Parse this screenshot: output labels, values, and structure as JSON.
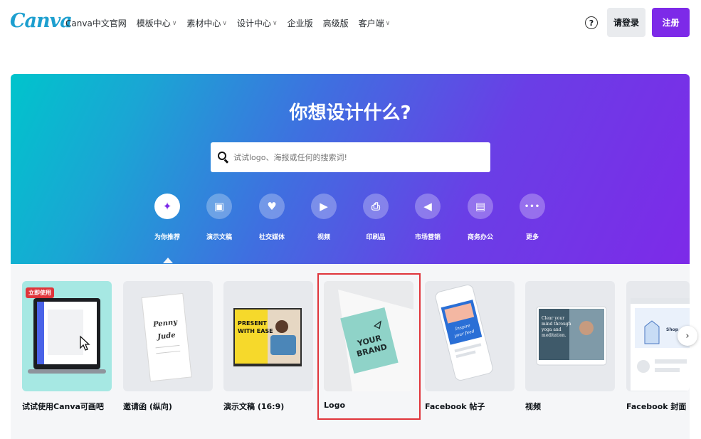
{
  "header": {
    "logo": "Canva",
    "nav": [
      {
        "label": "Canva中文官网",
        "has_chevron": false
      },
      {
        "label": "模板中心",
        "has_chevron": true
      },
      {
        "label": "素材中心",
        "has_chevron": true
      },
      {
        "label": "设计中心",
        "has_chevron": true
      },
      {
        "label": "企业版",
        "has_chevron": false
      },
      {
        "label": "高级版",
        "has_chevron": false
      },
      {
        "label": "客户端",
        "has_chevron": true
      }
    ],
    "chevron_glyph": "∨",
    "help_glyph": "?",
    "login_label": "请登录",
    "signup_label": "注册"
  },
  "hero": {
    "title": "你想设计什么?",
    "search_placeholder": "试试logo、海报或任何的搜索词!",
    "categories": [
      {
        "label": "为你推荐",
        "icon": "sparkle-icon",
        "glyph": "✦",
        "active": true
      },
      {
        "label": "演示文稿",
        "icon": "presentation-icon",
        "glyph": "▣",
        "active": false
      },
      {
        "label": "社交媒体",
        "icon": "social-heart-icon",
        "glyph": "♥",
        "active": false
      },
      {
        "label": "视频",
        "icon": "video-icon",
        "glyph": "▶",
        "active": false
      },
      {
        "label": "印刷品",
        "icon": "printer-icon",
        "glyph": "⎙",
        "active": false
      },
      {
        "label": "市场营销",
        "icon": "megaphone-icon",
        "glyph": "◀",
        "active": false
      },
      {
        "label": "商务办公",
        "icon": "briefcase-icon",
        "glyph": "▤",
        "active": false
      },
      {
        "label": "更多",
        "icon": "more-icon",
        "glyph": "•••",
        "active": false
      }
    ]
  },
  "templates": {
    "badge": "立即使用",
    "next_glyph": "›",
    "items": [
      {
        "label": "试试使用Canva可画吧"
      },
      {
        "label": "邀请函 (纵向)",
        "thumb_text": "Penny Jude"
      },
      {
        "label": "演示文稿 (16:9)",
        "thumb_text": "PRESENT WITH EASE"
      },
      {
        "label": "Logo",
        "thumb_text": "YOUR BRAND",
        "selected": true
      },
      {
        "label": "Facebook 帖子",
        "thumb_text": "Inspire your feed"
      },
      {
        "label": "视频",
        "thumb_text": "Clear your mind through yoga and meditation."
      },
      {
        "label": "Facebook 封面",
        "thumb_text": "Shop"
      }
    ]
  },
  "colors": {
    "brand_purple": "#7d2ae8",
    "brand_teal": "#00c4cc",
    "selection_red": "#e0353b"
  }
}
